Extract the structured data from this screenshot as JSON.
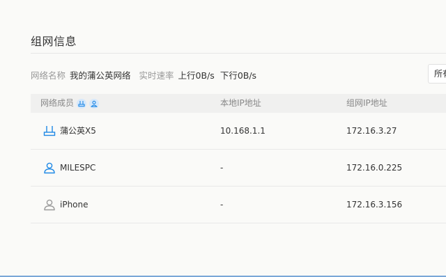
{
  "section": {
    "title": "组网信息"
  },
  "info": {
    "network_name_label": "网络名称",
    "network_name_value": "我的蒲公英网络",
    "speed_label": "实时速率",
    "upload": "上行0B/s",
    "download": "下行0B/s"
  },
  "filter": {
    "selected": "所有"
  },
  "table": {
    "headers": {
      "members": "网络成员",
      "local_ip": "本地IP地址",
      "network_ip": "组网IP地址"
    },
    "rows": [
      {
        "name": "蒲公英X5",
        "icon": "router-icon",
        "local_ip": "10.168.1.1",
        "network_ip": "172.16.3.27"
      },
      {
        "name": "MILESPC",
        "icon": "user-icon",
        "local_ip": "-",
        "network_ip": "172.16.0.225"
      },
      {
        "name": "iPhone",
        "icon": "user-offline-icon",
        "local_ip": "-",
        "network_ip": "172.16.3.156"
      }
    ]
  },
  "colors": {
    "accent": "#1e88e5",
    "offline": "#9a9a9a",
    "header_bg": "#f0f0ef"
  }
}
